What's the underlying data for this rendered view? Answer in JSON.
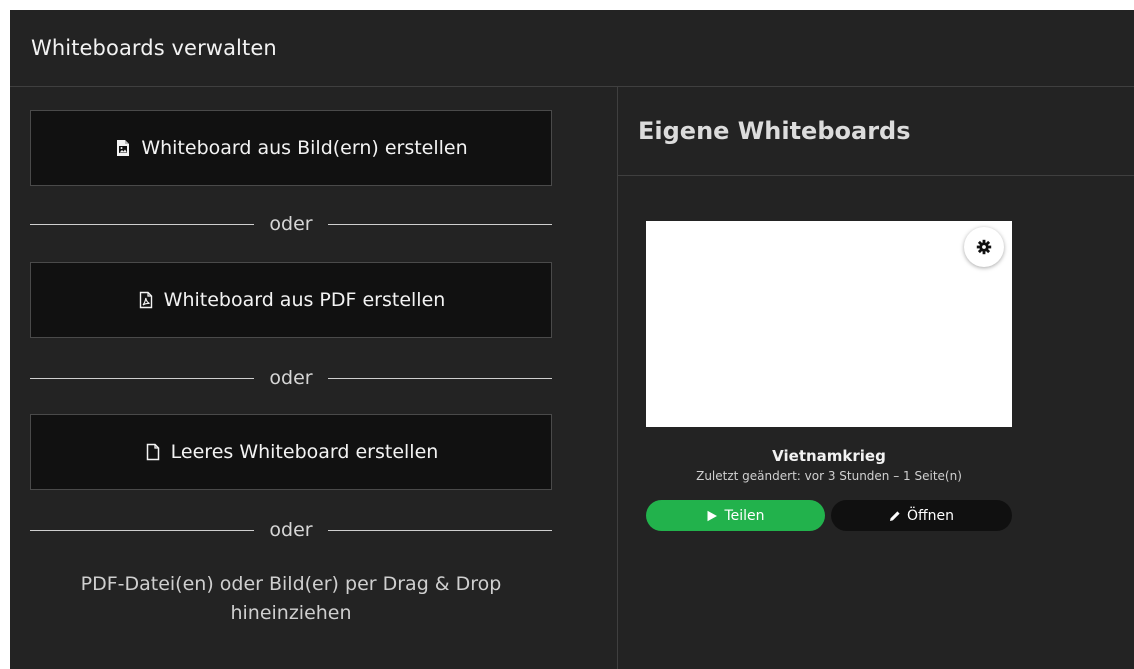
{
  "header": {
    "title": "Whiteboards verwalten"
  },
  "left": {
    "buttons": [
      {
        "label": "Whiteboard aus Bild(ern) erstellen",
        "icon": "image-file-icon"
      },
      {
        "label": "Whiteboard aus PDF erstellen",
        "icon": "pdf-file-icon"
      },
      {
        "label": "Leeres Whiteboard erstellen",
        "icon": "blank-file-icon"
      }
    ],
    "separator": "oder",
    "dragdrop_line1": "PDF-Datei(en) oder Bild(er) per Drag & Drop",
    "dragdrop_line2": "hineinziehen"
  },
  "right": {
    "title": "Eigene Whiteboards",
    "card": {
      "name": "Vietnamkrieg",
      "meta": "Zuletzt geändert: vor 3 Stunden – 1 Seite(n)",
      "share_label": "Teilen",
      "open_label": "Öffnen",
      "settings_icon": "gear-icon"
    }
  },
  "colors": {
    "background": "#232323",
    "button_bg": "#111111",
    "share_green": "#22b24c",
    "open_dark": "#101010"
  }
}
